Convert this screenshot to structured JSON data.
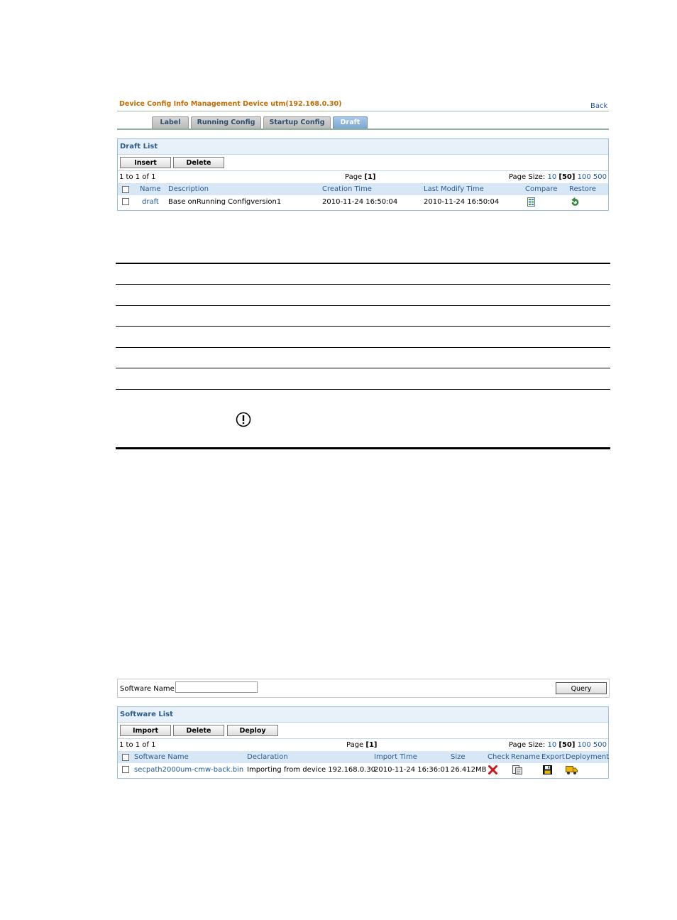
{
  "device_panel": {
    "title": "Device Config Info Management Device utm(192.168.0.30)",
    "back": "Back",
    "tabs": [
      {
        "label": "Label",
        "active": false
      },
      {
        "label": "Running Config",
        "active": false
      },
      {
        "label": "Startup Config",
        "active": false
      },
      {
        "label": "Draft",
        "active": true
      }
    ],
    "list_title": "Draft List",
    "buttons": {
      "insert": "Insert",
      "delete": "Delete"
    },
    "pager": {
      "count": "1 to 1 of 1",
      "page_label": "Page",
      "page_value": "[1]",
      "size_label": "Page Size:",
      "sizes": [
        "10",
        "[50]",
        "100",
        "500"
      ]
    },
    "columns": [
      "Name",
      "Description",
      "Creation Time",
      "Last Modify Time",
      "Compare",
      "Restore"
    ],
    "rows": [
      {
        "name": "draft",
        "description": "Base onRunning Configversion1",
        "creation_time": "2010-11-24 16:50:04",
        "last_modify_time": "2010-11-24 16:50:04"
      }
    ]
  },
  "software_panel": {
    "query_label": "Software Name",
    "query_value": "",
    "query_button": "Query",
    "list_title": "Software List",
    "buttons": {
      "import": "Import",
      "delete": "Delete",
      "deploy": "Deploy"
    },
    "pager": {
      "count": "1 to 1 of 1",
      "page_label": "Page",
      "page_value": "[1]",
      "size_label": "Page Size:",
      "sizes": [
        "10",
        "[50]",
        "100",
        "500"
      ]
    },
    "columns": [
      "Software Name",
      "Declaration",
      "Import Time",
      "Size",
      "Check",
      "Rename",
      "Export",
      "Deployment"
    ],
    "rows": [
      {
        "name": "secpath2000um-cmw-back.bin",
        "declaration": "Importing from device 192.168.0.30",
        "import_time": "2010-11-24 16:36:01",
        "size": "26.412MB"
      }
    ]
  },
  "colors": {
    "accent": "#c66b00",
    "link": "#1c5aa8",
    "header_bg": "#d7e7f5",
    "active_tab": "#7aa6d2"
  }
}
